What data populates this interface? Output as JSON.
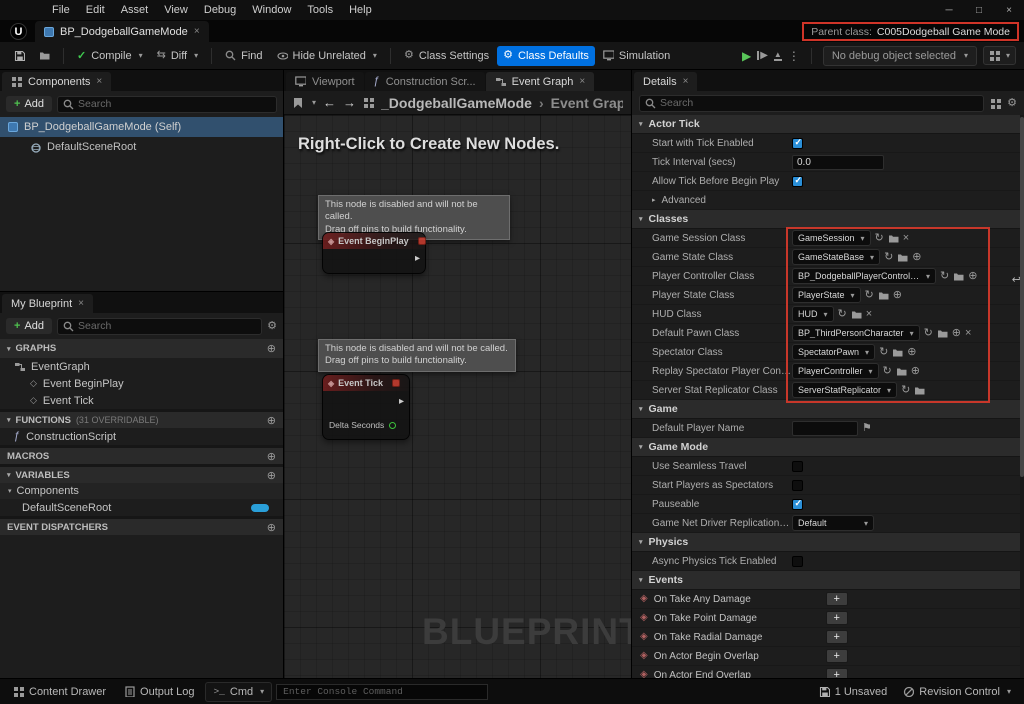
{
  "window": {
    "minimize": "─",
    "maximize": "□",
    "close": "×"
  },
  "menubar": {
    "items": [
      "File",
      "Edit",
      "Asset",
      "View",
      "Debug",
      "Window",
      "Tools",
      "Help"
    ]
  },
  "tabbar": {
    "asset_tab": "BP_DodgeballGameMode",
    "parent_class_label": "Parent class:",
    "parent_class_value": "C005Dodgeball Game Mode"
  },
  "toolbar": {
    "compile": "Compile",
    "diff": "Diff",
    "find": "Find",
    "hide_unrelated": "Hide Unrelated",
    "class_settings": "Class Settings",
    "class_defaults": "Class Defaults",
    "simulation": "Simulation",
    "debug_select": "No debug object selected"
  },
  "components": {
    "tab": "Components",
    "add": "Add",
    "search_placeholder": "Search",
    "root_item": "BP_DodgeballGameMode (Self)",
    "child_item": "DefaultSceneRoot"
  },
  "my_blueprint": {
    "tab": "My Blueprint",
    "add": "Add",
    "search_placeholder": "Search",
    "graphs_header": "GRAPHS",
    "event_graph": "EventGraph",
    "event_beginplay": "Event BeginPlay",
    "event_tick": "Event Tick",
    "functions_header": "FUNCTIONS",
    "functions_badge": "(31 OVERRIDABLE)",
    "construction_script": "ConstructionScript",
    "macros_header": "MACROS",
    "variables_header": "VARIABLES",
    "variables_group": "Components",
    "default_scene_root": "DefaultSceneRoot",
    "event_dispatchers_header": "EVENT DISPATCHERS"
  },
  "graph": {
    "tab_viewport": "Viewport",
    "tab_construction": "Construction Scr...",
    "tab_event_graph": "Event Graph",
    "breadcrumb_root": "_DodgeballGameMode",
    "breadcrumb_sep": "›",
    "breadcrumb_current": "Event Graph",
    "hint": "Right-Click to Create New Nodes.",
    "tooltip_line1": "This node is disabled and will not be called.",
    "tooltip_line2": "Drag off pins to build functionality.",
    "node_beginplay": "Event BeginPlay",
    "node_tick": "Event Tick",
    "pin_delta": "Delta Seconds",
    "watermark": "BLUEPRINT"
  },
  "details": {
    "tab": "Details",
    "search_placeholder": "Search",
    "actor_tick": {
      "header": "Actor Tick",
      "start_tick": "Start with Tick Enabled",
      "interval_label": "Tick Interval (secs)",
      "interval_value": "0.0",
      "allow_tick": "Allow Tick Before Begin Play",
      "advanced": "Advanced"
    },
    "classes": {
      "header": "Classes",
      "rows": [
        {
          "label": "Game Session Class",
          "value": "GameSession"
        },
        {
          "label": "Game State Class",
          "value": "GameStateBase"
        },
        {
          "label": "Player Controller Class",
          "value": "BP_DodgeballPlayerController"
        },
        {
          "label": "Player State Class",
          "value": "PlayerState"
        },
        {
          "label": "HUD Class",
          "value": "HUD"
        },
        {
          "label": "Default Pawn Class",
          "value": "BP_ThirdPersonCharacter"
        },
        {
          "label": "Spectator Class",
          "value": "SpectatorPawn"
        },
        {
          "label": "Replay Spectator Player Controller Cl...",
          "value": "PlayerController"
        },
        {
          "label": "Server Stat Replicator Class",
          "value": "ServerStatReplicator"
        }
      ]
    },
    "game": {
      "header": "Game",
      "player_name_label": "Default Player Name"
    },
    "game_mode": {
      "header": "Game Mode",
      "seamless": "Use Seamless Travel",
      "spectators": "Start Players as Spectators",
      "pauseable": "Pauseable",
      "net_driver_label": "Game Net Driver Replication System",
      "net_driver_value": "Default"
    },
    "physics": {
      "header": "Physics",
      "async_tick": "Async Physics Tick Enabled"
    },
    "events": {
      "header": "Events",
      "rows": [
        "On Take Any Damage",
        "On Take Point Damage",
        "On Take Radial Damage",
        "On Actor Begin Overlap",
        "On Actor End Overlap"
      ]
    },
    "checks": {
      "start_tick": true,
      "allow_tick": true,
      "seamless": false,
      "spectators": false,
      "pauseable": true,
      "async_tick": false
    }
  },
  "statusbar": {
    "content_drawer": "Content Drawer",
    "output_log": "Output Log",
    "cmd": "Cmd",
    "console_placeholder": "Enter Console Command",
    "unsaved": "1 Unsaved",
    "revision_control": "Revision Control"
  },
  "colors": {
    "accent_blue": "#0070e0",
    "compile_green": "#3fc94f",
    "play_green": "#58c558",
    "highlight_red": "#cf3428",
    "checkbox_blue": "#2a8fd8",
    "pin_green": "#3fd43f"
  },
  "icons": {
    "caret": "▾",
    "tri_down": "▾",
    "tri_right": "▸",
    "close": "×",
    "plus": "+",
    "add_circle": "⊕",
    "use_asset": "↻",
    "clear": "×",
    "reset": "↩",
    "flag": "⚑",
    "gear": "⚙",
    "func": "ƒ",
    "diamond": "◇",
    "event_diamond": "◈",
    "back": "←",
    "forward": "→",
    "play": "▶",
    "step": "▶",
    "eject": "▲",
    "dots": "⋮",
    "check": "✓",
    "diff": "⇆",
    "ue": "U",
    "cmd_prompt": "&gt;_"
  }
}
